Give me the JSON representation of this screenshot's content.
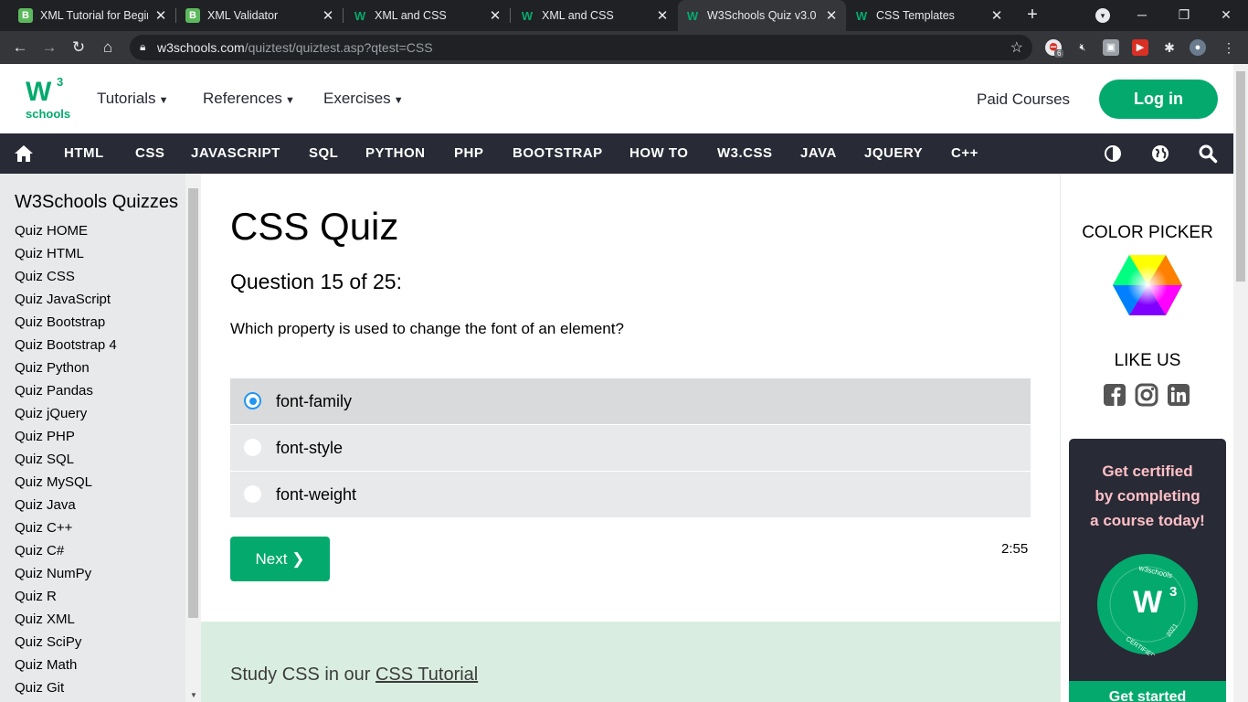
{
  "browser": {
    "tabs": [
      {
        "title": "XML Tutorial for Beginne",
        "favicon": "B"
      },
      {
        "title": "XML Validator",
        "favicon": "B"
      },
      {
        "title": "XML and CSS",
        "favicon": "W"
      },
      {
        "title": "XML and CSS",
        "favicon": "W"
      },
      {
        "title": "W3Schools Quiz v3.0",
        "favicon": "W"
      },
      {
        "title": "CSS Templates",
        "favicon": "W"
      }
    ],
    "url_host": "w3schools.com",
    "url_path": "/quiztest/quiztest.asp?qtest=CSS",
    "extension_badge": "6"
  },
  "site": {
    "logo_word": "schools",
    "logo_sup": "3",
    "menus": [
      "Tutorials",
      "References",
      "Exercises"
    ],
    "paid_courses": "Paid Courses",
    "login": "Log in",
    "nav": [
      "HTML",
      "CSS",
      "JAVASCRIPT",
      "SQL",
      "PYTHON",
      "PHP",
      "BOOTSTRAP",
      "HOW TO",
      "W3.CSS",
      "JAVA",
      "JQUERY",
      "C++"
    ]
  },
  "sidebar": {
    "title": "W3Schools Quizzes",
    "items": [
      "Quiz HOME",
      "Quiz HTML",
      "Quiz CSS",
      "Quiz JavaScript",
      "Quiz Bootstrap",
      "Quiz Bootstrap 4",
      "Quiz Python",
      "Quiz Pandas",
      "Quiz jQuery",
      "Quiz PHP",
      "Quiz SQL",
      "Quiz MySQL",
      "Quiz Java",
      "Quiz C++",
      "Quiz C#",
      "Quiz NumPy",
      "Quiz R",
      "Quiz XML",
      "Quiz SciPy",
      "Quiz Math",
      "Quiz Git"
    ]
  },
  "quiz": {
    "title": "CSS Quiz",
    "counter": "Question 15 of 25:",
    "question": "Which property is used to change the font of an element?",
    "options": [
      "font-family",
      "font-style",
      "font-weight"
    ],
    "selected_index": 0,
    "next_label": "Next ❯",
    "timer": "2:55",
    "study_prefix": "Study CSS in our ",
    "study_link": "CSS Tutorial"
  },
  "right": {
    "color_picker": "COLOR PICKER",
    "like_us": "LIKE US",
    "cert_lines": [
      "Get certified",
      "by completing",
      "a course today!"
    ],
    "cert_btn": "Get started"
  },
  "colors": {
    "brand_green": "#04aa6d",
    "nav_dark": "#282a35",
    "sidebar_bg": "#e7e9eb",
    "radio_blue": "#2196f3",
    "cert_text": "#ffc0c7"
  }
}
